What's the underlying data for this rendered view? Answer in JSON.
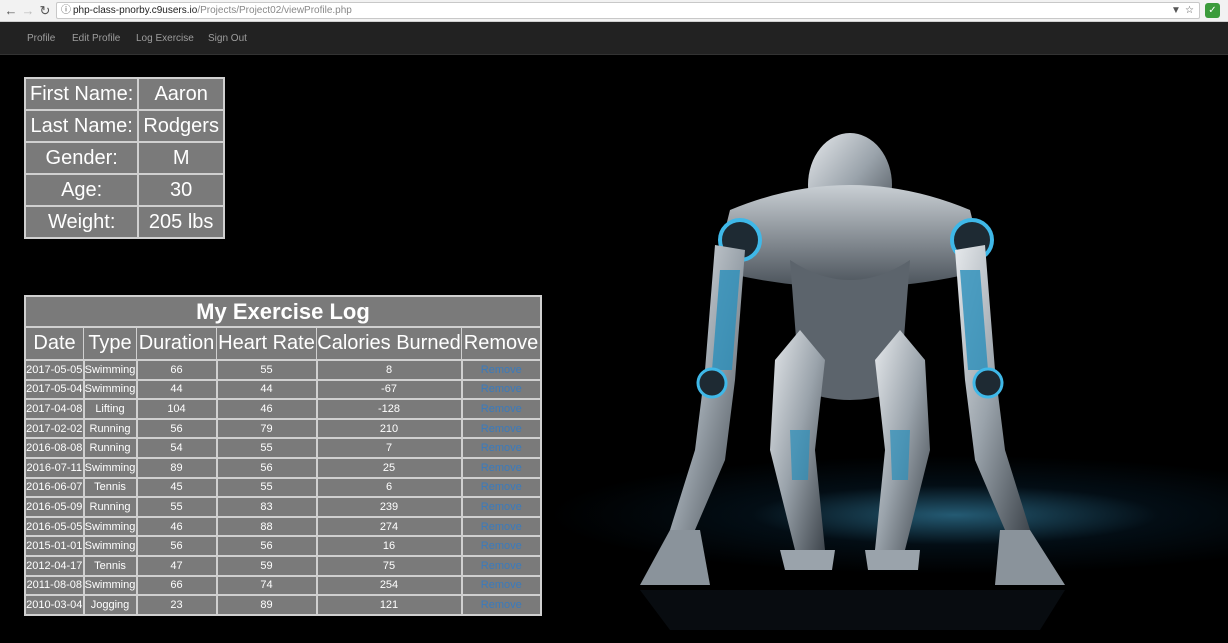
{
  "browser": {
    "url_host": "php-class-pnorby.c9users.io",
    "url_path": "/Projects/Project02/viewProfile.php"
  },
  "navbar": {
    "items": [
      "Profile",
      "Edit Profile",
      "Log Exercise",
      "Sign Out"
    ]
  },
  "profile": {
    "rows": [
      {
        "label": "First Name:",
        "value": "Aaron"
      },
      {
        "label": "Last Name:",
        "value": "Rodgers"
      },
      {
        "label": "Gender:",
        "value": "M"
      },
      {
        "label": "Age:",
        "value": "30"
      },
      {
        "label": "Weight:",
        "value": "205 lbs"
      }
    ]
  },
  "log": {
    "title": "My Exercise Log",
    "columns": [
      "Date",
      "Type",
      "Duration",
      "Heart Rate",
      "Calories Burned",
      "Remove"
    ],
    "remove_label": "Remove",
    "rows": [
      [
        "2017-05-05",
        "Swimming",
        "66",
        "55",
        "8"
      ],
      [
        "2017-05-04",
        "Swimming",
        "44",
        "44",
        "-67"
      ],
      [
        "2017-04-08",
        "Lifting",
        "104",
        "46",
        "-128"
      ],
      [
        "2017-02-02",
        "Running",
        "56",
        "79",
        "210"
      ],
      [
        "2016-08-08",
        "Running",
        "54",
        "55",
        "7"
      ],
      [
        "2016-07-11",
        "Swimming",
        "89",
        "56",
        "25"
      ],
      [
        "2016-06-07",
        "Tennis",
        "45",
        "55",
        "6"
      ],
      [
        "2016-05-09",
        "Running",
        "55",
        "83",
        "239"
      ],
      [
        "2016-05-05",
        "Swimming",
        "46",
        "88",
        "274"
      ],
      [
        "2015-01-01",
        "Swimming",
        "56",
        "56",
        "16"
      ],
      [
        "2012-04-17",
        "Tennis",
        "47",
        "59",
        "75"
      ],
      [
        "2011-08-08",
        "Swimming",
        "66",
        "74",
        "254"
      ],
      [
        "2010-03-04",
        "Jogging",
        "23",
        "89",
        "121"
      ]
    ]
  },
  "colors": {
    "table_bg": "#7a7a7a",
    "table_border": "#d0d0d0",
    "navbar_bg": "#222222",
    "link_blue": "#3a7bbd",
    "robot_accent": "#3fb8e8"
  }
}
